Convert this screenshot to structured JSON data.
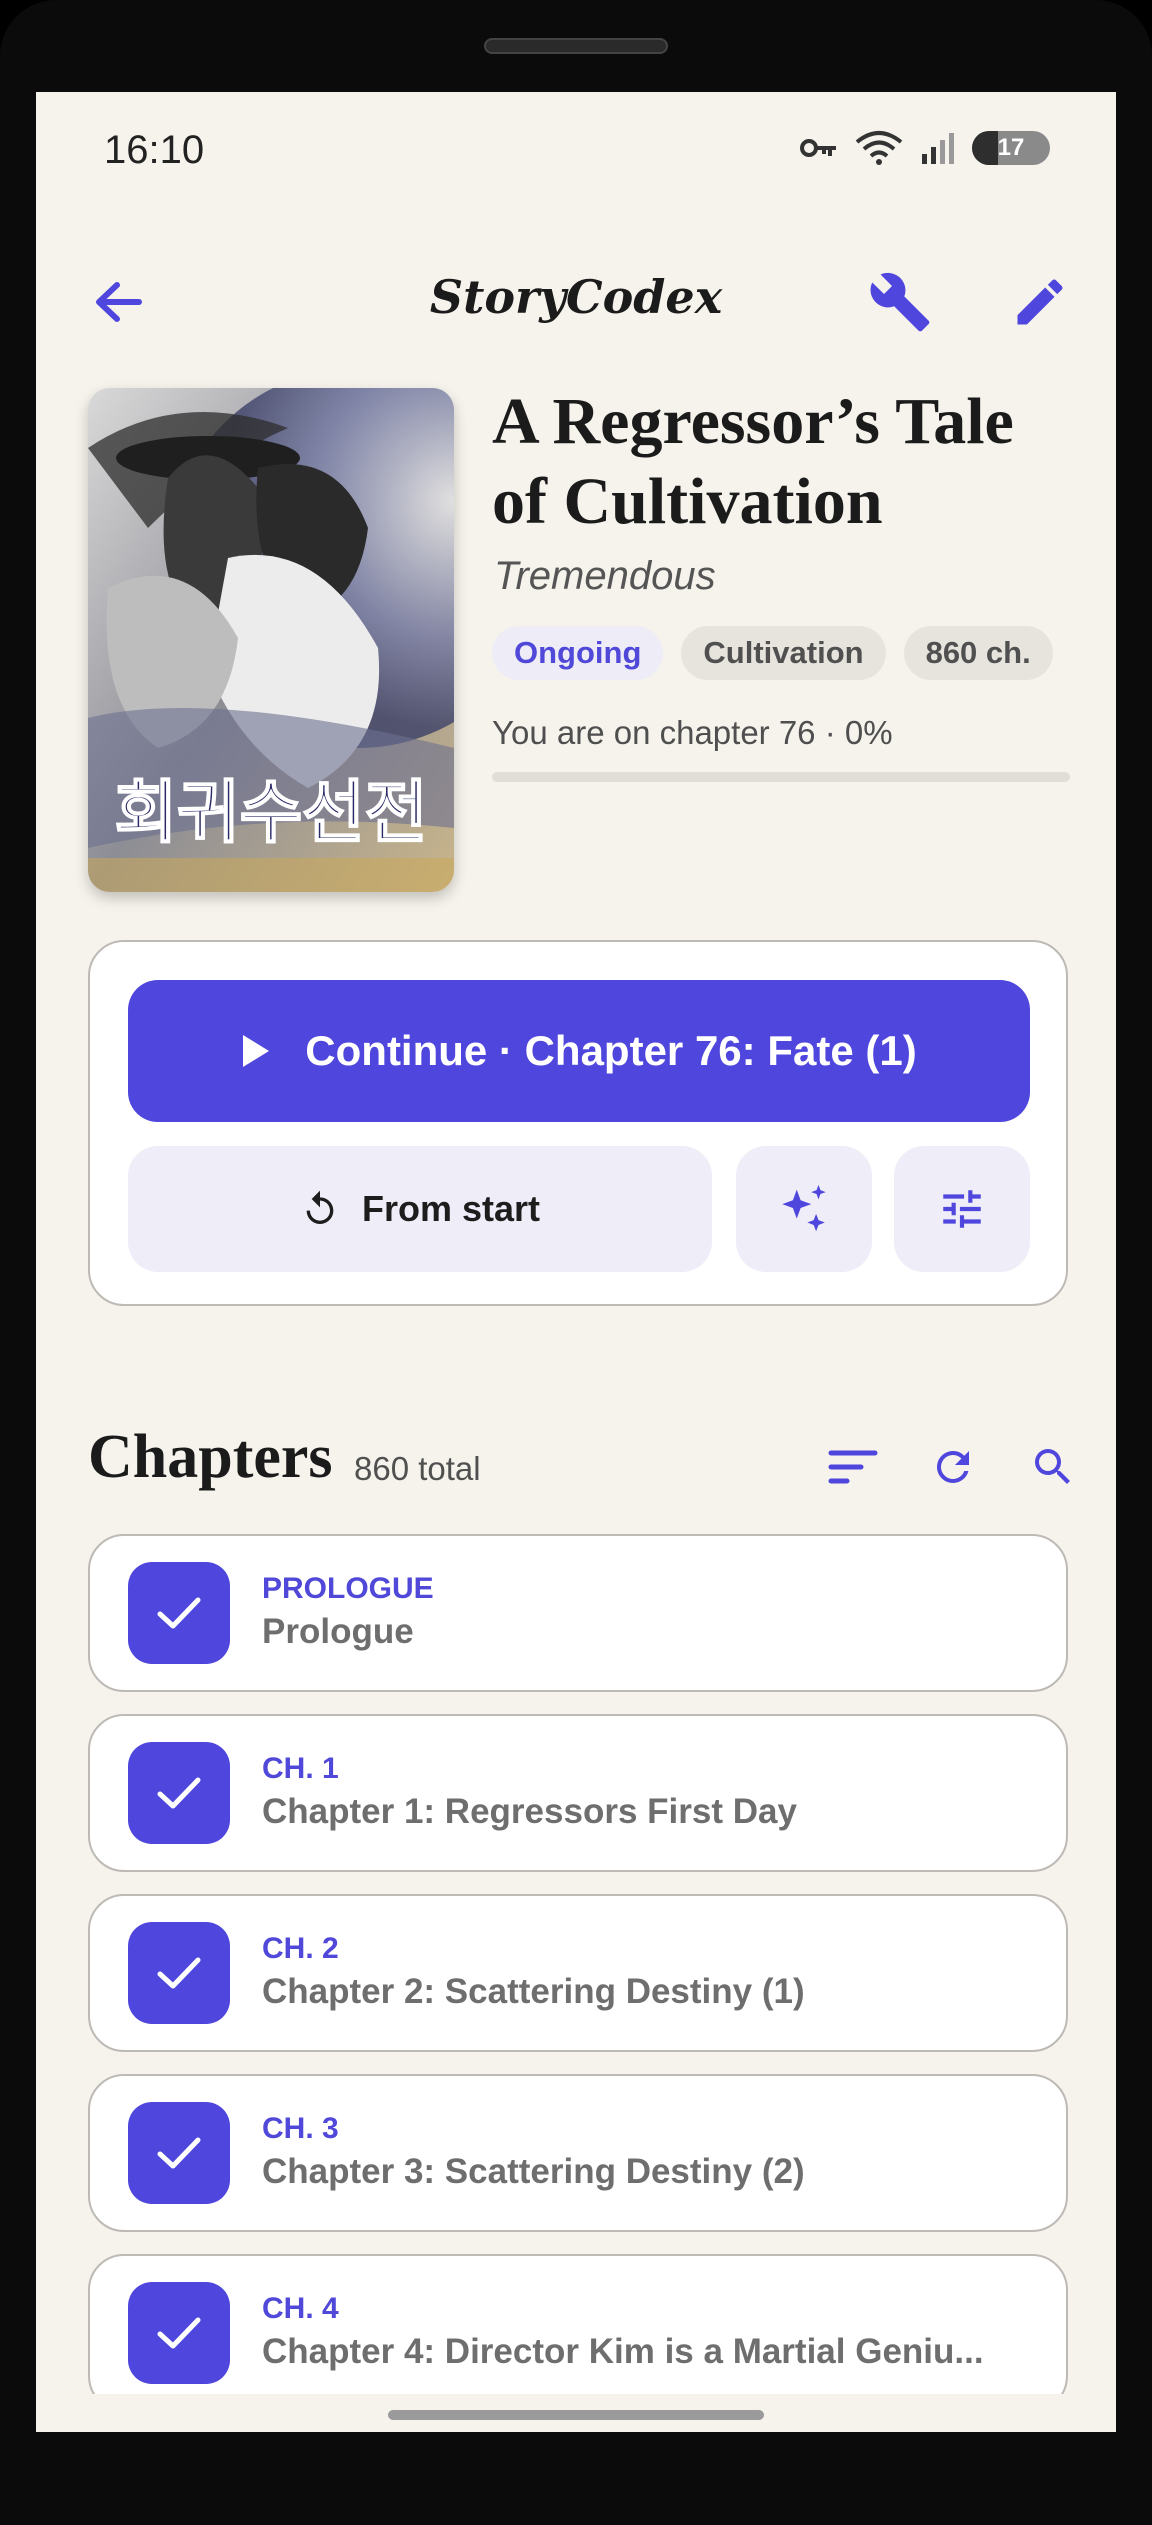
{
  "status_bar": {
    "time": "16:10",
    "battery": "17"
  },
  "app_bar": {
    "title": "StoryCodex"
  },
  "book": {
    "title": "A Regressor’s Tale of Cultivation",
    "author": "Tremendous",
    "tags": [
      "Ongoing",
      "Cultivation",
      "860 ch."
    ],
    "progress_text": "You are on chapter 76 · 0%",
    "progress_fraction": 0.0
  },
  "actions": {
    "continue_label": "Continue · Chapter 76: Fate (1)",
    "restart_label": "From start"
  },
  "chapters": {
    "heading": "Chapters",
    "total": "860 total",
    "items": [
      {
        "number": "PROLOGUE",
        "title": "Prologue"
      },
      {
        "number": "CH. 1",
        "title": "Chapter 1: Regressors First Day"
      },
      {
        "number": "CH. 2",
        "title": "Chapter 2: Scattering Destiny (1)"
      },
      {
        "number": "CH. 3",
        "title": "Chapter 3: Scattering Destiny (2)"
      },
      {
        "number": "CH. 4",
        "title": "Chapter 4: Director Kim is a Martial Geniu..."
      }
    ]
  },
  "colors": {
    "accent": "#4f46dd",
    "background": "#f6f3ec",
    "card": "#ffffff"
  },
  "icons": [
    "arrow-back-icon",
    "wrench-icon",
    "pencil-icon",
    "play-icon",
    "restart-icon",
    "sparkle-icon",
    "tune-icon",
    "sort-icon",
    "refresh-icon",
    "search-icon",
    "check-icon"
  ]
}
